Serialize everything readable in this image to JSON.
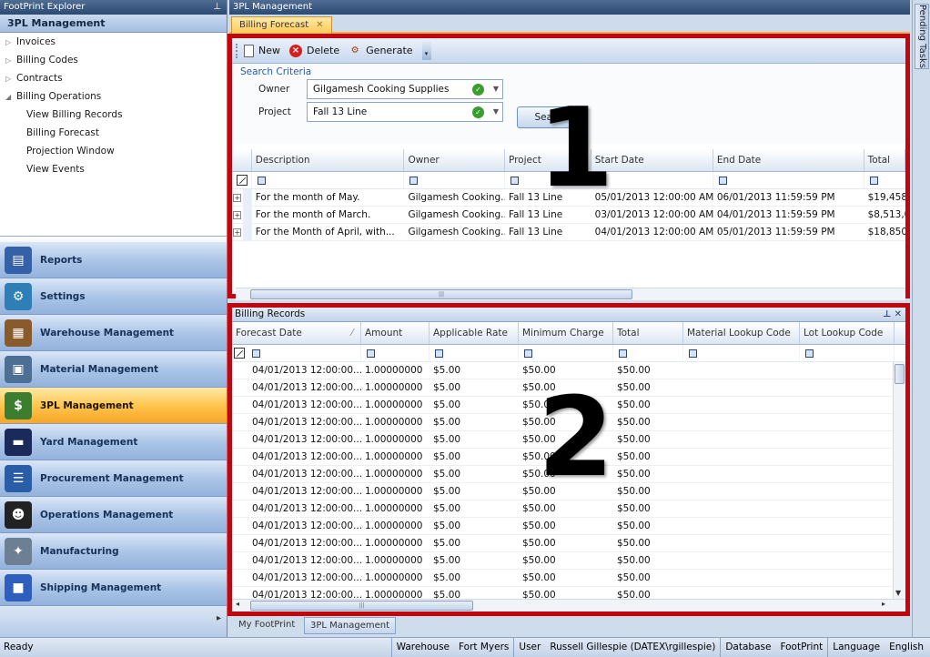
{
  "explorer": {
    "title": "FootPrint Explorer",
    "pin": "⊥",
    "section": "3PL Management",
    "tree": [
      {
        "label": "Invoices",
        "level": 1,
        "toggle": "▷"
      },
      {
        "label": "Billing Codes",
        "level": 1,
        "toggle": "▷"
      },
      {
        "label": "Contracts",
        "level": 1,
        "toggle": "▷"
      },
      {
        "label": "Billing Operations",
        "level": 1,
        "toggle": "◢"
      },
      {
        "label": "View Billing Records",
        "level": 2
      },
      {
        "label": "Billing Forecast",
        "level": 2
      },
      {
        "label": "Projection Window",
        "level": 2
      },
      {
        "label": "View Events",
        "level": 2
      }
    ],
    "modules": [
      {
        "label": "Reports",
        "icon": "reports-icon",
        "color": "#3561a8",
        "glyph": "▤"
      },
      {
        "label": "Settings",
        "icon": "settings-icon",
        "color": "#2f7fb7",
        "glyph": "⚙"
      },
      {
        "label": "Warehouse Management",
        "icon": "warehouse-icon",
        "color": "#8a5a2a",
        "glyph": "▦"
      },
      {
        "label": "Material Management",
        "icon": "material-icon",
        "color": "#4d6f93",
        "glyph": "▣"
      },
      {
        "label": "3PL Management",
        "icon": "3pl-icon",
        "color": "#3c7d2f",
        "glyph": "$",
        "active": true
      },
      {
        "label": "Yard Management",
        "icon": "yard-icon",
        "color": "#1a2a5a",
        "glyph": "▬"
      },
      {
        "label": "Procurement Management",
        "icon": "procurement-icon",
        "color": "#2a5da8",
        "glyph": "☰"
      },
      {
        "label": "Operations Management",
        "icon": "operations-icon",
        "color": "#222222",
        "glyph": "☻"
      },
      {
        "label": "Manufacturing",
        "icon": "manufacturing-icon",
        "color": "#6d7f92",
        "glyph": "✦"
      },
      {
        "label": "Shipping Management",
        "icon": "shipping-icon",
        "color": "#2e5fbf",
        "glyph": "■"
      }
    ],
    "more_arrows": "▸"
  },
  "document": {
    "title": "3PL Management",
    "tab": "Billing Forecast",
    "tab_close": "✕"
  },
  "pending_tasks": "Pending Tasks",
  "toolbar": {
    "new": "New",
    "delete": "Delete",
    "generate": "Generate",
    "more": "▾"
  },
  "criteria": {
    "link": "Search Criteria",
    "owner_label": "Owner",
    "owner_value": "Gilgamesh Cooking Supplies",
    "project_label": "Project",
    "project_value": "Fall 13 Line",
    "search_button": "Search"
  },
  "forecast_grid": {
    "columns": [
      "Description",
      "Owner",
      "Project",
      "Start Date",
      "End Date",
      "Total"
    ],
    "rows": [
      [
        "For the month of May.",
        "Gilgamesh Cooking...",
        "Fall 13 Line",
        "05/01/2013 12:00:00 AM",
        "06/01/2013 11:59:59 PM",
        "$19,458"
      ],
      [
        "For the month of March.",
        "Gilgamesh Cooking...",
        "Fall 13 Line",
        "03/01/2013 12:00:00 AM",
        "04/01/2013 11:59:59 PM",
        "$8,513,0"
      ],
      [
        "For the Month of April, with...",
        "Gilgamesh Cooking...",
        "Fall 13 Line",
        "04/01/2013 12:00:00 AM",
        "05/01/2013 11:59:59 PM",
        "$18,850"
      ]
    ],
    "expander": "+"
  },
  "billing_records": {
    "title": "Billing Records",
    "controls": "⊥ ✕",
    "columns": [
      "Forecast Date",
      "Amount",
      "Applicable Rate",
      "Minimum Charge",
      "Total",
      "Material Lookup Code",
      "Lot Lookup Code"
    ],
    "sort_glyph": "⁄",
    "row_template": [
      "04/01/2013 12:00:00...",
      "1.00000000",
      "$5.00",
      "$50.00",
      "$50.00",
      "",
      ""
    ],
    "row_count": 14
  },
  "bottom_tabs": [
    "My FootPrint",
    "3PL Management"
  ],
  "status": {
    "ready": "Ready",
    "segments": [
      "Warehouse",
      "Fort Myers",
      "User",
      "Russell Gillespie (DATEX\\rgillespie)",
      "Database",
      "FootPrint",
      "Language",
      "English"
    ]
  },
  "callouts": [
    "1",
    "2"
  ],
  "colors": {
    "highlight_border": "#c3060d",
    "active_module": "#ffc248"
  }
}
